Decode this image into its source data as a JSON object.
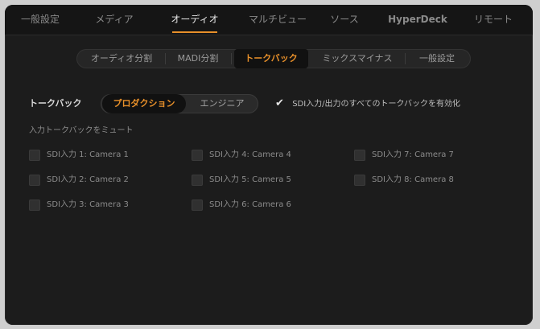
{
  "top_tabs": [
    {
      "label": "一般設定"
    },
    {
      "label": "メディア"
    },
    {
      "label": "オーディオ",
      "active": true
    },
    {
      "label": "マルチビュー"
    },
    {
      "label": "ソース"
    },
    {
      "label": "HyperDeck"
    },
    {
      "label": "リモート"
    }
  ],
  "sub_tabs": [
    {
      "label": "オーディオ分割"
    },
    {
      "label": "MADI分割"
    },
    {
      "label": "トークバック",
      "active": true
    },
    {
      "label": "ミックスマイナス"
    },
    {
      "label": "一般設定"
    }
  ],
  "talkback": {
    "label": "トークバック",
    "options": [
      "プロダクション",
      "エンジニア"
    ],
    "selected": "プロダクション",
    "enable_all_label": "SDI入力/出力のすべてのトークバックを有効化",
    "enable_all_checked": true
  },
  "mute": {
    "heading": "入力トークバックをミュート",
    "inputs": [
      {
        "label": "SDI入力 1: Camera 1",
        "checked": false
      },
      {
        "label": "SDI入力 2: Camera 2",
        "checked": false
      },
      {
        "label": "SDI入力 3: Camera 3",
        "checked": false
      },
      {
        "label": "SDI入力 4: Camera 4",
        "checked": false
      },
      {
        "label": "SDI入力 5: Camera 5",
        "checked": false
      },
      {
        "label": "SDI入力 6: Camera 6",
        "checked": false
      },
      {
        "label": "SDI入力 7: Camera 7",
        "checked": false
      },
      {
        "label": "SDI入力 8: Camera 8",
        "checked": false
      }
    ]
  },
  "colors": {
    "accent": "#e8902a",
    "panel_bg": "#1c1c1c"
  }
}
